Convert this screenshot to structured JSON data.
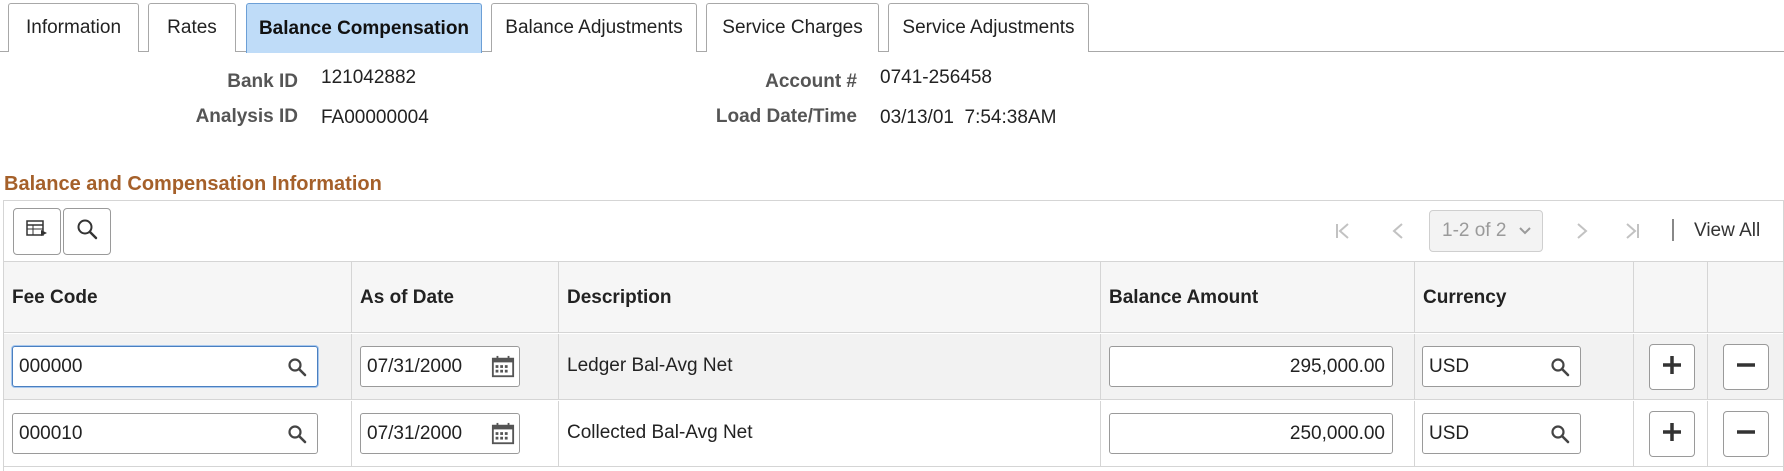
{
  "tabs": [
    {
      "label": "Information",
      "active": false
    },
    {
      "label": "Rates",
      "active": false
    },
    {
      "label": "Balance Compensation",
      "active": true
    },
    {
      "label": "Balance Adjustments",
      "active": false
    },
    {
      "label": "Service Charges",
      "active": false
    },
    {
      "label": "Service Adjustments",
      "active": false
    }
  ],
  "header": {
    "bank_id_label": "Bank ID",
    "bank_id": "121042882",
    "analysis_id_label": "Analysis ID",
    "analysis_id": "FA00000004",
    "account_label": "Account #",
    "account": "0741-256458",
    "load_date_label": "Load Date/Time",
    "load_date": "03/13/01  7:54:38AM"
  },
  "section_title": "Balance and Compensation Information",
  "grid": {
    "pager_text": "1-2 of 2",
    "view_all": "View All",
    "columns": [
      "Fee Code",
      "As of Date",
      "Description",
      "Balance Amount",
      "Currency"
    ],
    "rows": [
      {
        "fee_code": "000000",
        "as_of_date": "07/31/2000",
        "description": "Ledger Bal-Avg Net",
        "balance_amount": "295,000.00",
        "currency": "USD"
      },
      {
        "fee_code": "000010",
        "as_of_date": "07/31/2000",
        "description": "Collected Bal-Avg Net",
        "balance_amount": "250,000.00",
        "currency": "USD"
      }
    ]
  },
  "colors": {
    "active_tab": "#bfdcf8",
    "section_title": "#a5602a",
    "header_row": "#f6f6f6"
  },
  "icons": {
    "toolbar": [
      "grid-personalize-icon",
      "find-icon"
    ],
    "navigation": [
      "first-page-icon",
      "previous-page-icon",
      "next-page-icon",
      "last-page-icon"
    ],
    "row": [
      "lookup-icon",
      "calendar-icon",
      "add-row-icon",
      "delete-row-icon"
    ]
  }
}
